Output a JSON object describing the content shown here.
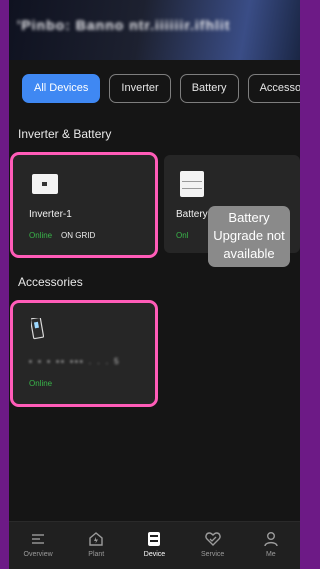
{
  "header": {
    "title_obscured": "'Pinbo: Banno ntr.iiiiiir.ifhlit"
  },
  "tabs": [
    {
      "label": "All Devices",
      "active": true
    },
    {
      "label": "Inverter",
      "active": false
    },
    {
      "label": "Battery",
      "active": false
    },
    {
      "label": "Accessories",
      "active": false
    }
  ],
  "sections": {
    "inverter_battery": "Inverter & Battery",
    "accessories": "Accessories"
  },
  "devices": {
    "inverter": {
      "name": "Inverter-1",
      "status": "Online",
      "mode": "ON GRID"
    },
    "battery": {
      "name": "Battery-",
      "status": "Onl"
    },
    "accessory": {
      "name_obscured": "▪ ▪   ▪  ▪▪ ▪▪▪  . . . 5",
      "status": "Online"
    }
  },
  "tooltip": {
    "text_line1": "Battery",
    "text_line2": "Upgrade not",
    "text_line3": "available"
  },
  "nav": [
    {
      "label": "Overview",
      "icon": "overview-icon",
      "active": false
    },
    {
      "label": "Plant",
      "icon": "plant-icon",
      "active": false
    },
    {
      "label": "Device",
      "icon": "device-icon",
      "active": true
    },
    {
      "label": "Service",
      "icon": "service-icon",
      "active": false
    },
    {
      "label": "Me",
      "icon": "me-icon",
      "active": false
    }
  ],
  "colors": {
    "accent": "#3f88f3",
    "online": "#39b54a",
    "highlight": "#ff5cb8",
    "background": "#151515",
    "frame": "#6d1a86"
  }
}
